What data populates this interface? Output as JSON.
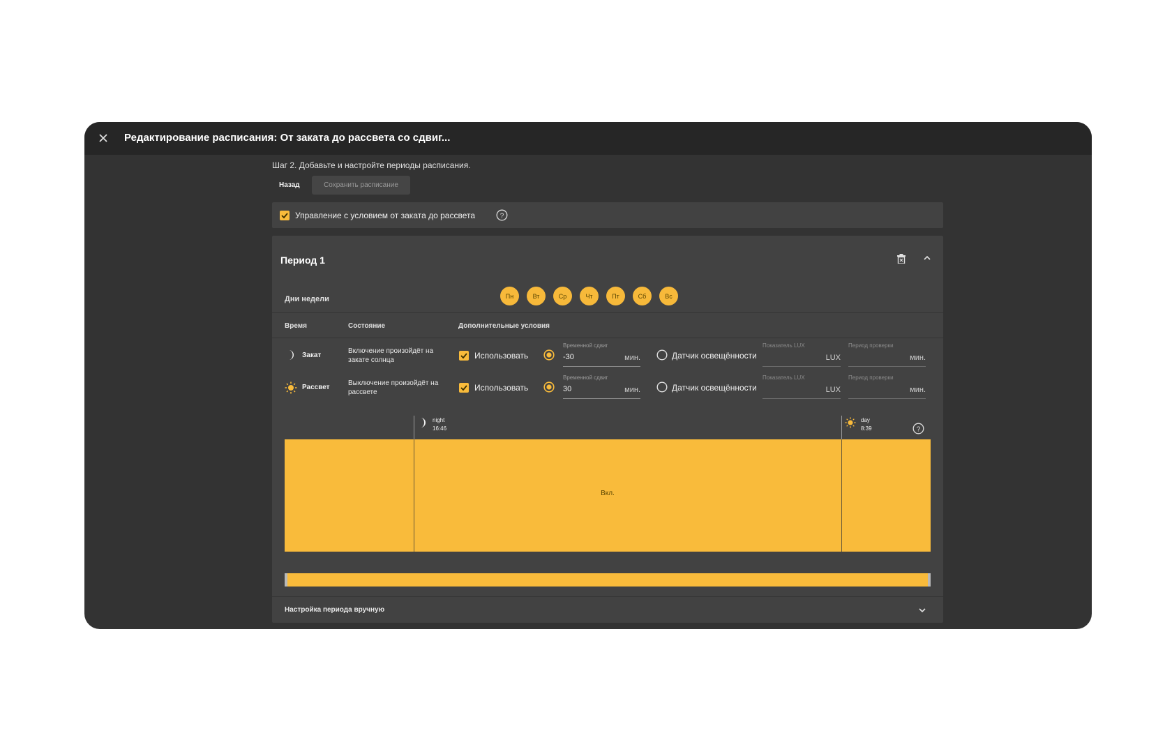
{
  "header": {
    "title": "Редактирование расписания: От заката до рассвета со сдвиг..."
  },
  "step_text": "Шаг 2. Добавьте и настройте периоды расписания.",
  "buttons": {
    "back": "Назад",
    "save": "Сохранить расписание"
  },
  "condition": {
    "label": "Управление с условием от заката до рассвета",
    "checked": true
  },
  "period": {
    "title": "Период 1",
    "days_label": "Дни недели",
    "days": [
      "Пн",
      "Вт",
      "Ср",
      "Чт",
      "Пт",
      "Сб",
      "Вс"
    ],
    "columns": {
      "time": "Время",
      "state": "Состояние",
      "extra": "Дополнительные условия"
    },
    "rows": [
      {
        "name": "Закат",
        "icon": "moon-icon",
        "state": "Включение произойдёт на закате солнца",
        "use_label": "Использовать",
        "shift_label": "Временной сдвиг",
        "shift_value": "-30",
        "shift_unit": "мин.",
        "sensor_label": "Датчик освещённости",
        "lux_label": "Показатель LUX",
        "lux_unit": "LUX",
        "check_label": "Период проверки",
        "check_unit": "мин."
      },
      {
        "name": "Рассвет",
        "icon": "sun-icon",
        "state": "Выключение произойдёт на рассвете",
        "use_label": "Использовать",
        "shift_label": "Временной сдвиг",
        "shift_value": "30",
        "shift_unit": "мин.",
        "sensor_label": "Датчик освещённости",
        "lux_label": "Показатель LUX",
        "lux_unit": "LUX",
        "check_label": "Период проверки",
        "check_unit": "мин."
      }
    ],
    "timeline": {
      "night": {
        "label": "night",
        "time": "16:46"
      },
      "day": {
        "label": "day",
        "time": "8:39"
      },
      "state_label": "Вкл."
    },
    "manual_label": "Настройка периода вручную"
  },
  "colors": {
    "accent": "#f9bb3b",
    "panel": "#424242",
    "background": "#333333",
    "titlebar": "#262626"
  }
}
